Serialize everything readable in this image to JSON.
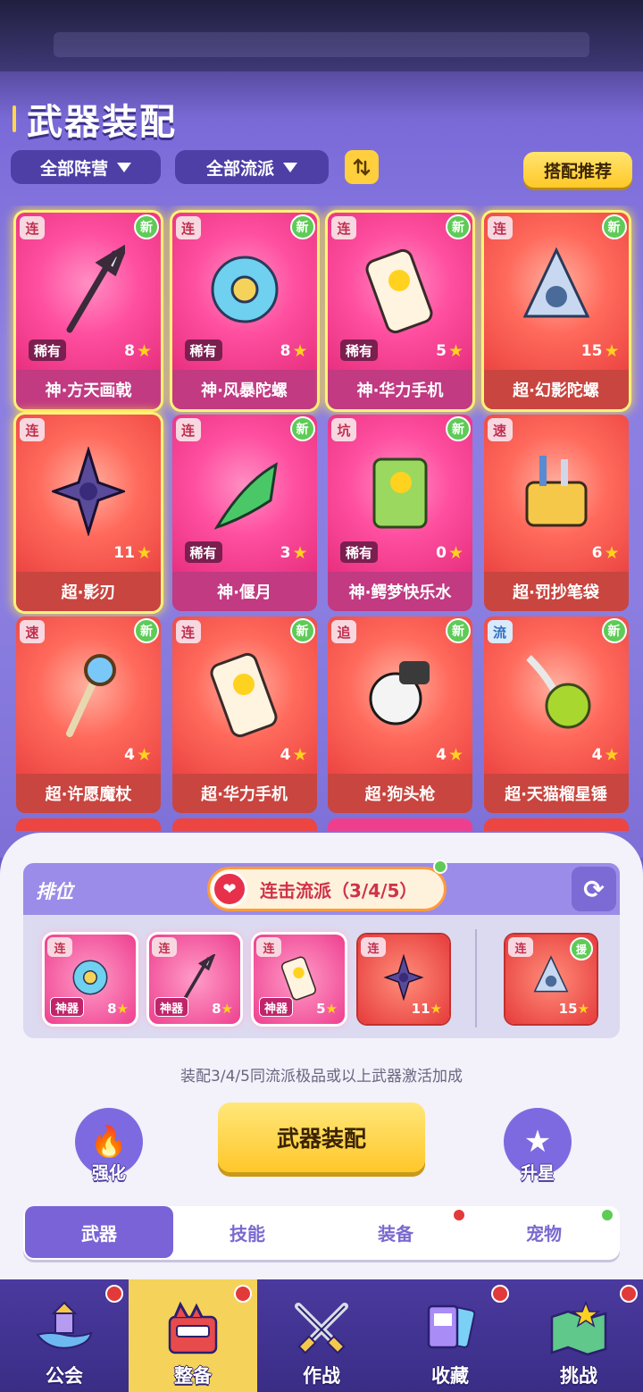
{
  "header": {
    "title": "武器装配"
  },
  "filters": {
    "faction": "全部阵营",
    "school": "全部流派",
    "sort_icon": "sort-arrows-icon",
    "recommend": "搭配推荐"
  },
  "weapons": [
    {
      "tag": "连",
      "new": "新",
      "rare": "稀有",
      "stars": "8",
      "name": "神·方天画戟",
      "grade": "god",
      "glow": true
    },
    {
      "tag": "连",
      "new": "新",
      "rare": "稀有",
      "stars": "8",
      "name": "神·风暴陀螺",
      "grade": "god",
      "glow": true
    },
    {
      "tag": "连",
      "new": "新",
      "rare": "稀有",
      "stars": "5",
      "name": "神·华力手机",
      "grade": "god",
      "glow": true
    },
    {
      "tag": "连",
      "new": "新",
      "rare": "",
      "stars": "15",
      "name": "超·幻影陀螺",
      "grade": "super",
      "glow": true
    },
    {
      "tag": "连",
      "new": "",
      "rare": "",
      "stars": "11",
      "name": "超·影刃",
      "grade": "super",
      "glow": true
    },
    {
      "tag": "连",
      "new": "新",
      "rare": "稀有",
      "stars": "3",
      "name": "神·偃月",
      "grade": "god",
      "glow": false
    },
    {
      "tag": "坑",
      "new": "新",
      "rare": "稀有",
      "stars": "0",
      "name": "神·鳄梦快乐水",
      "grade": "god",
      "glow": false
    },
    {
      "tag": "速",
      "new": "",
      "rare": "",
      "stars": "6",
      "name": "超·罚抄笔袋",
      "grade": "super",
      "glow": false
    },
    {
      "tag": "速",
      "new": "新",
      "rare": "",
      "stars": "4",
      "name": "超·许愿魔杖",
      "grade": "super",
      "glow": false
    },
    {
      "tag": "连",
      "new": "新",
      "rare": "",
      "stars": "4",
      "name": "超·华力手机",
      "grade": "super",
      "glow": false
    },
    {
      "tag": "追",
      "new": "新",
      "rare": "",
      "stars": "4",
      "name": "超·狗头枪",
      "grade": "super",
      "glow": false
    },
    {
      "tag": "流",
      "new": "新",
      "rare": "",
      "stars": "4",
      "name": "超·天猫榴星锤",
      "grade": "super",
      "glow": false
    }
  ],
  "ranking": {
    "label": "排位",
    "combo": "连击流派（3/4/5）",
    "slots": [
      {
        "tag": "连",
        "badge": "神器",
        "stars": "8",
        "grade": "god"
      },
      {
        "tag": "连",
        "badge": "神器",
        "stars": "8",
        "grade": "god"
      },
      {
        "tag": "连",
        "badge": "神器",
        "stars": "5",
        "grade": "god"
      },
      {
        "tag": "连",
        "badge": "",
        "stars": "11",
        "grade": "super"
      }
    ],
    "assist": {
      "tag": "连",
      "help": "援",
      "stars": "15"
    }
  },
  "hint": "装配3/4/5同流派极品或以上武器激活加成",
  "actions": {
    "enhance": "强化",
    "equip": "武器装配",
    "upstar": "升星"
  },
  "tabs": [
    "武器",
    "技能",
    "装备",
    "宠物"
  ],
  "nav": [
    "公会",
    "整备",
    "作战",
    "收藏",
    "挑战"
  ],
  "colors": {
    "accent": "#7a63d6",
    "gold": "#ffc928",
    "god_card": "#ee3f8f",
    "super_card": "#ec4542",
    "new_badge": "#5ecb57",
    "alert_dot": "#e23a3a"
  }
}
